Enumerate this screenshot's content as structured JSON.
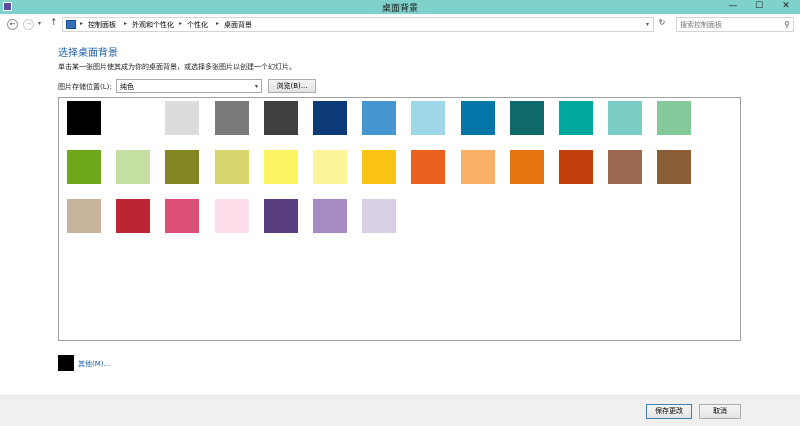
{
  "window": {
    "title": "桌面背景",
    "min_glyph": "—",
    "max_glyph": "☐",
    "close_glyph": "✕"
  },
  "nav": {
    "back_glyph": "←",
    "forward_glyph": "→",
    "dropdown_glyph": "▾",
    "up_glyph": "↑",
    "separator_glyph": "▸",
    "breadcrumbs": [
      "控制面板",
      "外观和个性化",
      "个性化",
      "桌面背景"
    ],
    "refresh_glyph": "↻",
    "search_placeholder": "搜索控制面板",
    "search_icon_glyph": "⚲"
  },
  "main": {
    "heading": "选择桌面背景",
    "description": "单击某一张图片使其成为你的桌面背景，或选择多张图片以创建一个幻灯片。",
    "location_label": "图片存储位置(L):",
    "location_value": "纯色",
    "location_caret": "▾",
    "browse_label": "浏览(B)...",
    "other_link": "其他(M)...",
    "other_color": "#000000",
    "swatch_colors": [
      "#000000",
      "#ffffff",
      "#dcdcdc",
      "#7a7a7a",
      "#404040",
      "#0c3a79",
      "#4696d2",
      "#9ed8e8",
      "#0375a8",
      "#0f6b6b",
      "#00a99d",
      "#7ccdc5",
      "#84c99a",
      "#6fa71b",
      "#c5e0a2",
      "#828620",
      "#d9d66f",
      "#fdf463",
      "#fdf49a",
      "#fbc313",
      "#eb621e",
      "#f9b066",
      "#e57510",
      "#c1400b",
      "#9d6a51",
      "#8b5f36",
      "#c8b39c",
      "#bd2532",
      "#da4f73",
      "#fcdde9",
      "#583d7e",
      "#a58bbf",
      "#d8cfe4"
    ]
  },
  "footer": {
    "save_label": "保存更改",
    "cancel_label": "取消"
  }
}
